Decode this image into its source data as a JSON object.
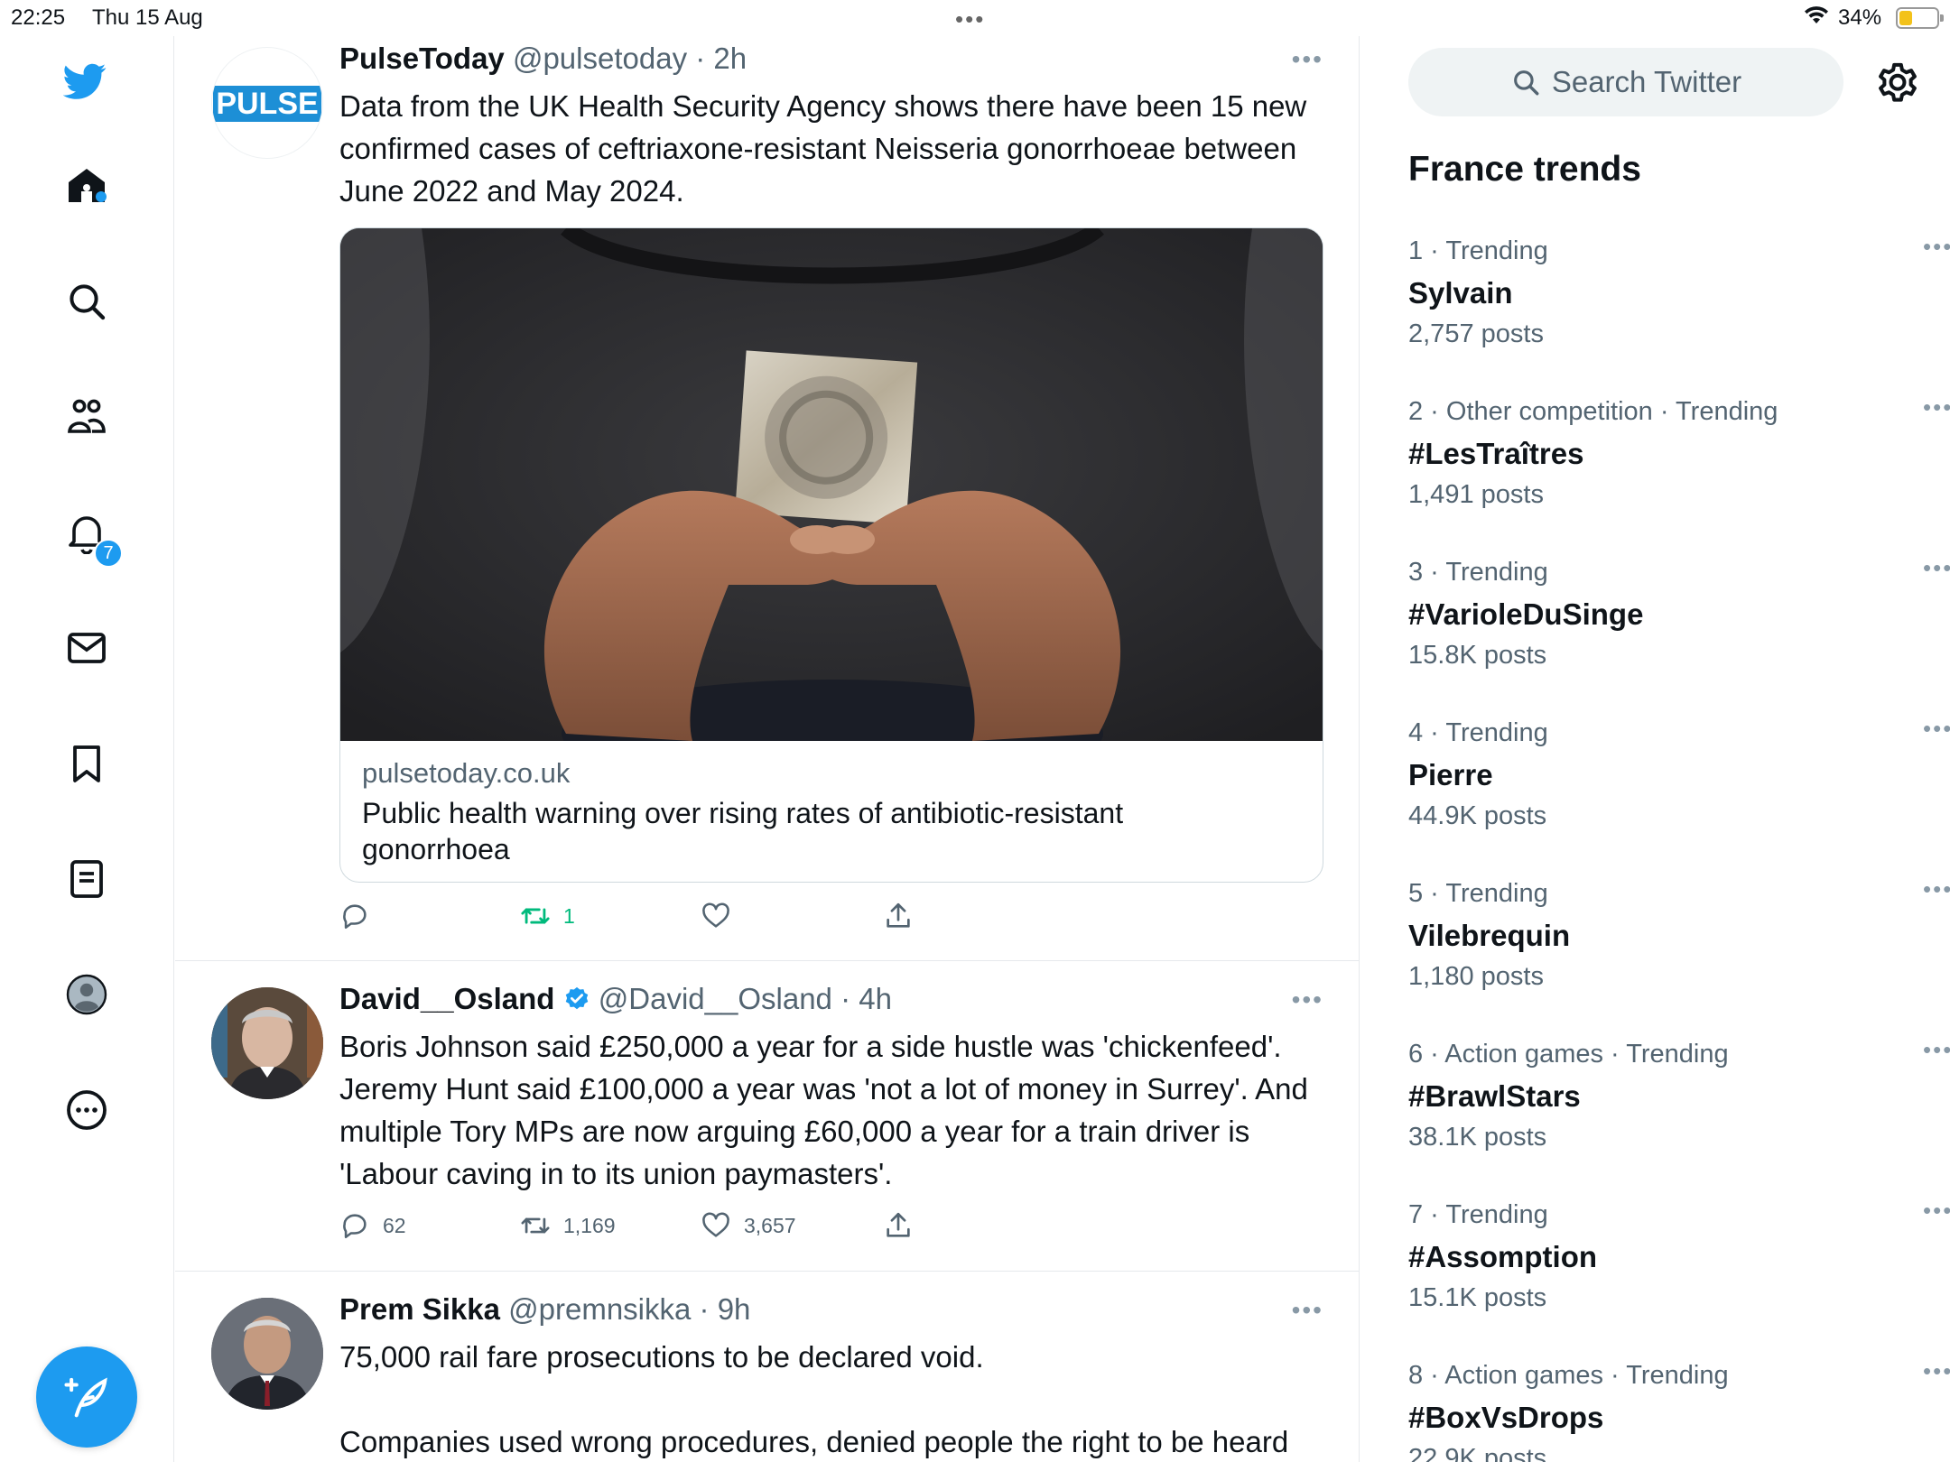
{
  "status_bar": {
    "time": "22:25",
    "date": "Thu 15 Aug",
    "battery_percent": "34%",
    "battery_level": 0.34
  },
  "nav": {
    "home_has_new": true,
    "notifications_count": "7",
    "brand_color": "#1d9bf0"
  },
  "tweets": [
    {
      "name": "PulseToday",
      "handle": "@pulsetoday",
      "time": "· 2h",
      "avatar_text": "PULSE",
      "text": "Data from the UK Health Security Agency shows there have been 15 new confirmed cases of ceftriaxone-resistant Neisseria gonorrhoeae between June 2022 and May 2024.",
      "card": {
        "domain": "pulsetoday.co.uk",
        "title": "Public health warning over rising rates of antibiotic-resistant gonorrhoea"
      },
      "reply_count": "",
      "retweet_count": "1",
      "like_count": "",
      "retweeted": true
    },
    {
      "name": "David__Osland",
      "handle": "@David__Osland",
      "time": "· 4h",
      "verified": true,
      "text": "Boris Johnson said £250,000 a year for a side hustle was 'chickenfeed'. Jeremy Hunt said £100,000 a year was 'not a lot of money in Surrey'. And multiple Tory MPs are now arguing £60,000 a year for a train driver is 'Labour caving in to its union paymasters'.",
      "reply_count": "62",
      "retweet_count": "1,169",
      "like_count": "3,657"
    },
    {
      "name": "Prem Sikka",
      "handle": "@premnsikka",
      "time": "· 9h",
      "text_line1": "75,000 rail fare prosecutions to be declared void.",
      "text_line2": "Companies used wrong procedures, denied people the right to be heard"
    }
  ],
  "right": {
    "search_placeholder": "Search Twitter",
    "trends_title": "France trends",
    "trends": [
      {
        "meta": "1 · Trending",
        "title": "Sylvain",
        "posts": "2,757 posts"
      },
      {
        "meta": "2 · Other competition · Trending",
        "title": "#LesTraîtres",
        "posts": "1,491 posts"
      },
      {
        "meta": "3 · Trending",
        "title": "#VarioleDuSinge",
        "posts": "15.8K posts"
      },
      {
        "meta": "4 · Trending",
        "title": "Pierre",
        "posts": "44.9K posts"
      },
      {
        "meta": "5 · Trending",
        "title": "Vilebrequin",
        "posts": "1,180 posts"
      },
      {
        "meta": "6 · Action games · Trending",
        "title": "#BrawlStars",
        "posts": "38.1K posts"
      },
      {
        "meta": "7 · Trending",
        "title": "#Assomption",
        "posts": "15.1K posts"
      },
      {
        "meta": "8 · Action games · Trending",
        "title": "#BoxVsDrops",
        "posts": "22.9K posts"
      }
    ]
  }
}
